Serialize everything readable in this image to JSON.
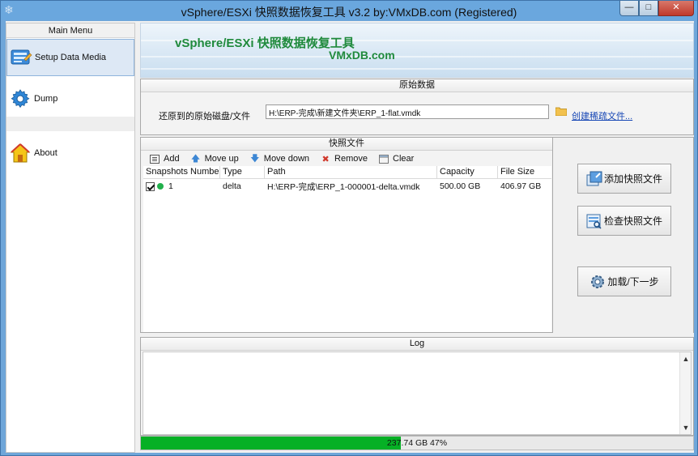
{
  "window": {
    "title": "vSphere/ESXi 快照数据恢复工具 v3.2 by:VMxDB.com (Registered)",
    "controls": {
      "minimize": "—",
      "maximize": "□",
      "close": "✕"
    }
  },
  "sidebar": {
    "header": "Main Menu",
    "items": [
      {
        "label": "Setup Data Media",
        "icon": "data-media-icon",
        "active": true
      },
      {
        "label": "Dump",
        "icon": "gear-icon",
        "active": false
      },
      {
        "label": "About",
        "icon": "home-icon",
        "active": false
      }
    ]
  },
  "banner": {
    "line1": "vSphere/ESXi 快照数据恢复工具",
    "line2": "VMxDB.com"
  },
  "source": {
    "header": "原始数据",
    "label": "还原到的原始磁盘/文件",
    "path": "H:\\ERP-完成\\新建文件夹\\ERP_1-flat.vmdk",
    "create_link": "创建稀疏文件..."
  },
  "snapshots": {
    "header": "快照文件",
    "toolbar": {
      "add": "Add",
      "move_up": "Move up",
      "move_down": "Move down",
      "remove": "Remove",
      "clear": "Clear"
    },
    "columns": [
      "Snapshots Number",
      "Type",
      "Path",
      "Capacity",
      "File Size"
    ],
    "rows": [
      {
        "checked": true,
        "number": "1",
        "type": "delta",
        "path": "H:\\ERP-完成\\ERP_1-000001-delta.vmdk",
        "capacity": "500.00 GB",
        "file_size": "406.97 GB"
      }
    ]
  },
  "actions": {
    "add_snapshot": "添加快照文件",
    "check_snapshot": "检查快照文件",
    "load_next": "加载/下一步"
  },
  "log": {
    "header": "Log"
  },
  "progress": {
    "text": "237.74 GB  47%",
    "fraction": 0.47
  },
  "colors": {
    "accent_green": "#06b025",
    "banner_text": "#1f8a3c",
    "link": "#1747b5"
  }
}
